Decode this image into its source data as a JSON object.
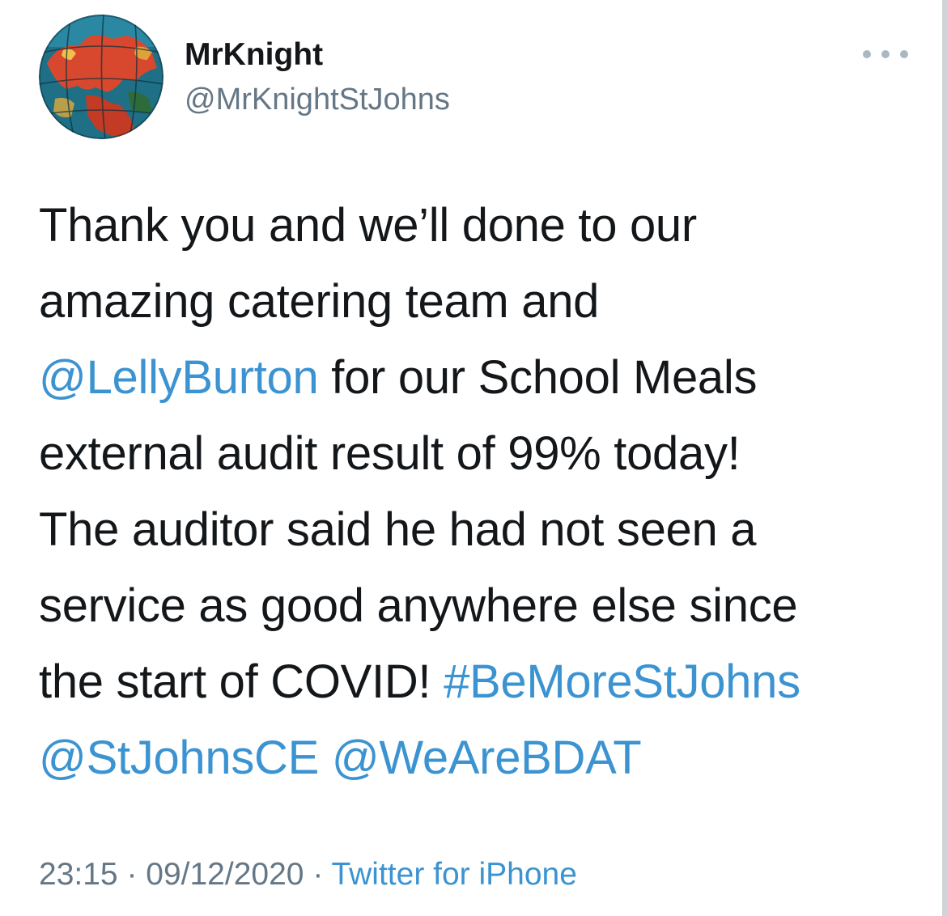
{
  "tweet": {
    "author": {
      "name": "MrKnight",
      "handle": "@MrKnightStJohns",
      "avatar_icon": "globe-avatar"
    },
    "more_icon": "more-horizontal-icon",
    "text": {
      "line1": "Thank you and we’ll done to our",
      "line2": "amazing catering team and",
      "mention_lellyburton": "@LellyBurton",
      "line3_rest": " for our School Meals",
      "line4": "external audit result of 99% today!",
      "line5": "The auditor said he had not seen a",
      "line6": "service as good anywhere else since",
      "line7_start": "the start of COVID! ",
      "hashtag_bemorestjohns": "#BeMoreStJohns",
      "mention_stjohnsce": "@StJohnsCE",
      "line8_space": " ",
      "mention_wearebdat": "@WeAreBDAT"
    },
    "meta": {
      "time": "23:15",
      "separator1": " · ",
      "date": "09/12/2020",
      "separator2": " · ",
      "source": "Twitter for iPhone"
    }
  },
  "colors": {
    "link": "#3b93d1",
    "text": "#14171a",
    "secondary": "#657786",
    "avatar_ocean": "#1f6f86",
    "avatar_land": "#d8482f"
  }
}
